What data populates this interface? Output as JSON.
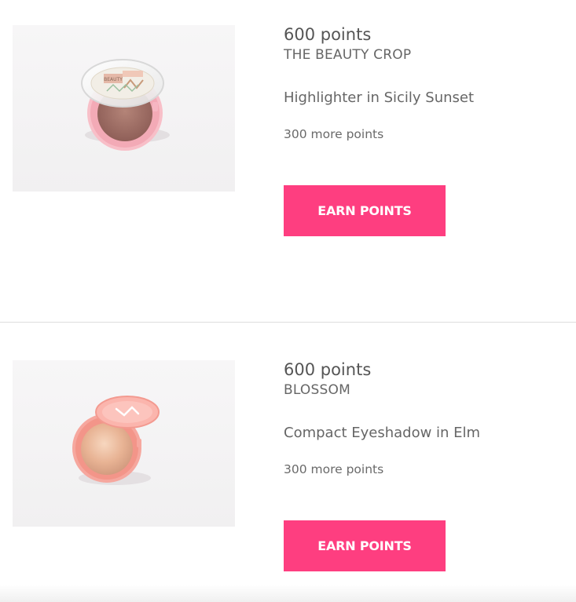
{
  "rewards": [
    {
      "points": "600 points",
      "brand": "THE BEAUTY CROP",
      "product": "Highlighter in Sicily Sunset",
      "more_points": "300 more points",
      "button_label": "EARN POINTS",
      "image_icon": "highlighter-compact-icon"
    },
    {
      "points": "600 points",
      "brand": "BLOSSOM",
      "product": "Compact Eyeshadow in Elm",
      "more_points": "300 more points",
      "button_label": "EARN POINTS",
      "image_icon": "eyeshadow-compact-icon"
    }
  ],
  "colors": {
    "accent": "#fe3e80",
    "text": "#5a5a5a",
    "divider": "#dedede"
  }
}
